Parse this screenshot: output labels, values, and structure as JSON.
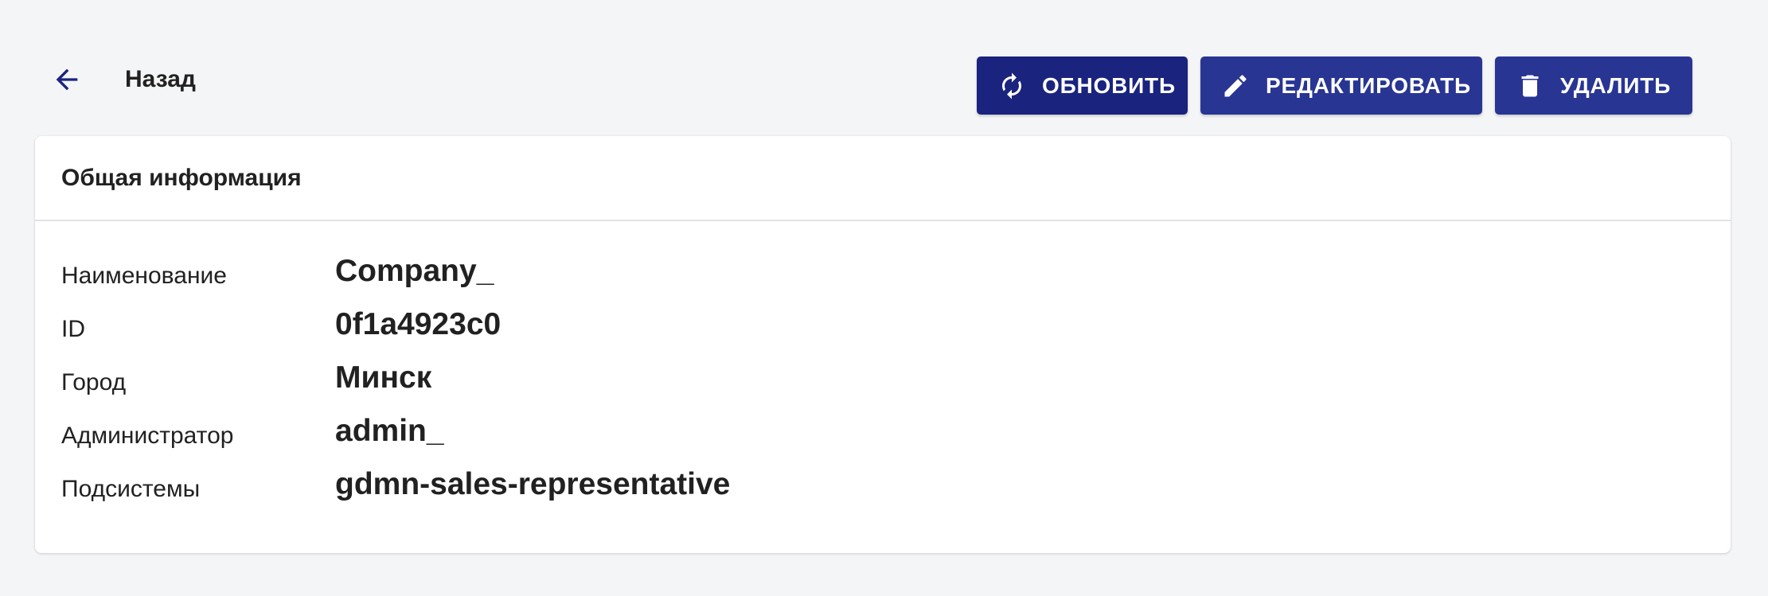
{
  "header": {
    "back_label": "Назад",
    "back_icon": "arrow-left-icon",
    "accent_color": "#1a237e"
  },
  "actions": {
    "refresh": {
      "label": "ОБНОВИТЬ",
      "icon": "refresh-icon",
      "color": "#1a237e"
    },
    "edit": {
      "label": "РЕДАКТИРОВАТЬ",
      "icon": "pencil-icon",
      "color": "#283593"
    },
    "delete": {
      "label": "УДАЛИТЬ",
      "icon": "trash-icon",
      "color": "#283593"
    }
  },
  "card": {
    "title": "Общая информация",
    "fields": [
      {
        "label": "Наименование",
        "value": "Company_"
      },
      {
        "label": "ID",
        "value": "0f1a4923c0"
      },
      {
        "label": "Город",
        "value": "Минск"
      },
      {
        "label": "Администратор",
        "value": "admin_"
      },
      {
        "label": "Подсистемы",
        "value": "gdmn-sales-representative"
      }
    ]
  }
}
